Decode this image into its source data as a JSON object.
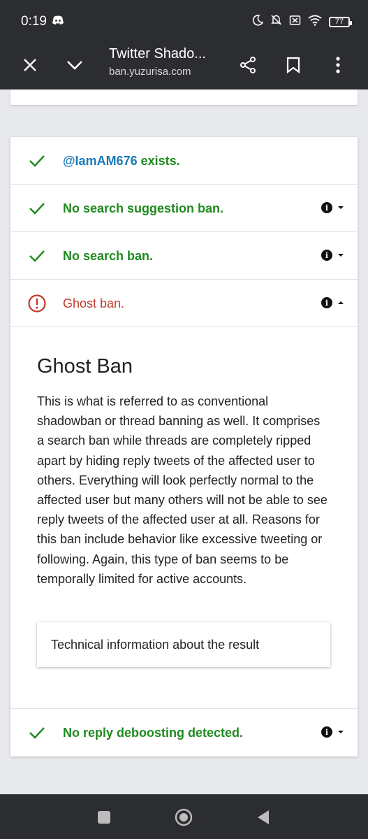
{
  "status_bar": {
    "time": "0:19",
    "battery": "77",
    "icons": [
      "discord-icon",
      "moon-icon",
      "bell-off-icon",
      "sim-off-icon",
      "wifi-icon",
      "battery-icon"
    ]
  },
  "toolbar": {
    "title": "Twitter Shado...",
    "url": "ban.yuzurisa.com",
    "icons": [
      "close-icon",
      "chevron-down-icon",
      "share-icon",
      "bookmark-icon",
      "more-vert-icon"
    ]
  },
  "results": {
    "exists": {
      "handle": "@IamAM676",
      "suffix": " exists.",
      "status": "ok"
    },
    "suggestion_ban": {
      "label": "No search suggestion ban.",
      "status": "ok"
    },
    "search_ban": {
      "label": "No search ban.",
      "status": "ok"
    },
    "ghost_ban": {
      "label": "Ghost ban.",
      "status": "error",
      "expanded": true
    },
    "reply_deboost": {
      "label": "No reply deboosting detected.",
      "status": "ok"
    }
  },
  "ghost_ban_detail": {
    "title": "Ghost Ban",
    "body": "This is what is referred to as conventional shadowban or thread banning as well. It comprises a search ban while threads are completely ripped apart by hiding reply tweets of the affected user to others. Everything will look perfectly normal to the affected user but many others will not be able to see reply tweets of the affected user at all. Reasons for this ban include behavior like excessive tweeting or following. Again, this type of ban seems to be temporally limited for active accounts.",
    "tech_label": "Technical information about the result"
  },
  "colors": {
    "ok": "#1e8a1e",
    "error": "#c0392b",
    "link": "#1a7ab8",
    "chrome": "#2c2d30",
    "background": "#e7e9ec"
  },
  "nav_bar": {
    "icons": [
      "recents-icon",
      "home-icon",
      "back-icon"
    ]
  }
}
